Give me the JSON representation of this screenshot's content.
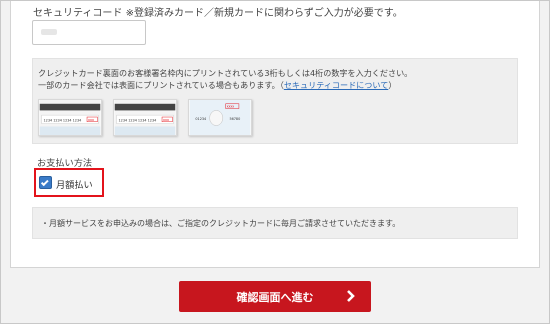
{
  "security_code": {
    "label": "セキュリティコード ※登録済みカード／新規カードに関わらずご入力が必要です。",
    "value": "",
    "placeholder": ""
  },
  "info": {
    "line1": "クレジットカード裏面のお客様署名枠内にプリントされている3桁もしくは4桁の数字を入力ください。",
    "line2_before": "一部のカード会社では表面にプリントされている場合もあります。（",
    "line2_link": "セキュリティコードについて",
    "line2_after": "）"
  },
  "card_images": [
    {
      "number": "1234 1234 1234 1234",
      "code": "xxx",
      "icon": "card-back-signature-image"
    },
    {
      "number": "1234 1234 1234 1234",
      "code": "xxx",
      "icon": "card-back-signature-image"
    },
    {
      "number": "01234",
      "number2": "56780",
      "code": "xxxx",
      "icon": "card-front-code-image"
    }
  ],
  "payment": {
    "label": "お支払い方法",
    "option_label": "月額払い",
    "checked": true
  },
  "note": {
    "text": "・月額サービスをお申込みの場合は、ご指定のクレジットカードに毎月ご請求させていただきます。"
  },
  "next_button": {
    "label": "確認画面へ進む",
    "icon": "chevron-right-icon"
  },
  "colors": {
    "accent_red": "#c7161e",
    "highlight_red": "#e3131b",
    "link_blue": "#2a6ab8",
    "checkbox_blue": "#3a7bc8"
  }
}
